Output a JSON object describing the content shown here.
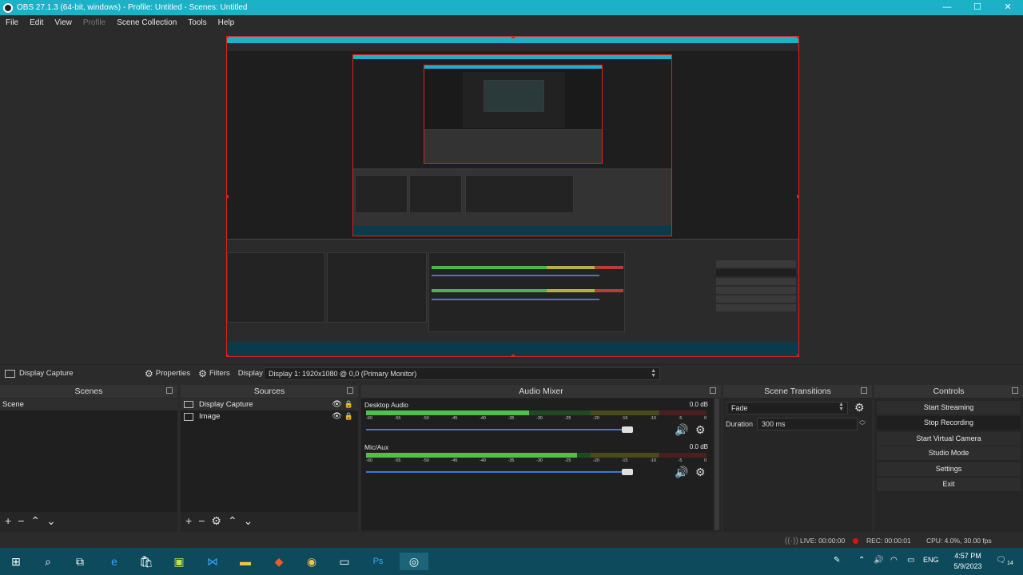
{
  "window": {
    "title": "OBS 27.1.3 (64-bit, windows) - Profile: Untitled - Scenes: Untitled",
    "min": "—",
    "max": "☐",
    "close": "✕"
  },
  "menu": [
    "File",
    "Edit",
    "View",
    "Profile",
    "Scene Collection",
    "Tools",
    "Help"
  ],
  "source_toolbar": {
    "source": "Display Capture",
    "properties": "Properties",
    "filters": "Filters",
    "display_label": "Display",
    "display_value": "Display 1: 1920x1080 @ 0,0 (Primary Monitor)"
  },
  "scenes": {
    "title": "Scenes",
    "items": [
      "Scene"
    ]
  },
  "sources": {
    "title": "Sources",
    "items": [
      "Display Capture",
      "Image"
    ]
  },
  "mixer": {
    "title": "Audio Mixer",
    "channels": [
      {
        "name": "Desktop Audio",
        "db": "0.0 dB",
        "level": 0.48,
        "volume": 0.86
      },
      {
        "name": "Mic/Aux",
        "db": "0.0 dB",
        "level": 0.62,
        "volume": 0.86
      }
    ],
    "ticks": [
      "-60",
      "-55",
      "-50",
      "-45",
      "-40",
      "-35",
      "-30",
      "-25",
      "-20",
      "-15",
      "-10",
      "-5",
      "0"
    ]
  },
  "transitions": {
    "title": "Scene Transitions",
    "type": "Fade",
    "duration_label": "Duration",
    "duration_value": "300 ms"
  },
  "controls": {
    "title": "Controls",
    "buttons": [
      "Start Streaming",
      "Stop Recording",
      "Start Virtual Camera",
      "Studio Mode",
      "Settings",
      "Exit"
    ]
  },
  "status": {
    "live": "LIVE: 00:00:00",
    "rec": "REC: 00:00:01",
    "cpu": "CPU: 4.0%, 30.00 fps"
  },
  "taskbar": {
    "lang": "ENG",
    "time": "4:57 PM",
    "date": "5/9/2023",
    "notifications": "14"
  },
  "colors": {
    "accent": "#1bb1c6",
    "rec": "#dd1111",
    "slider": "#3a7bd5",
    "selection": "#e02020"
  }
}
